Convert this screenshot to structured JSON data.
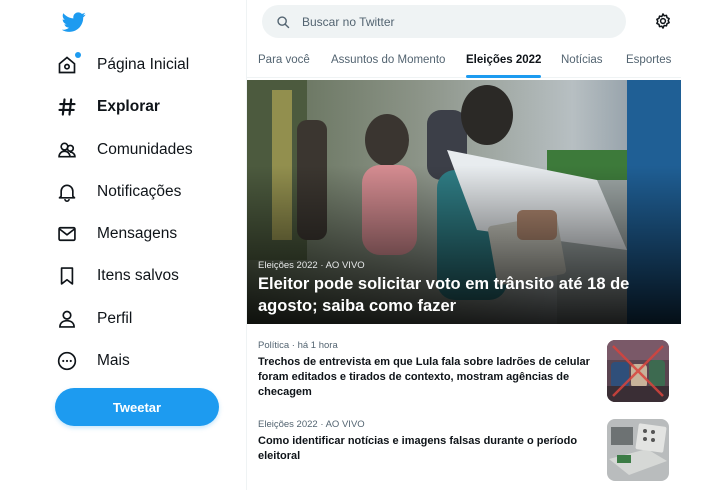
{
  "sidebar": {
    "items": [
      {
        "label": "Página Inicial",
        "icon": "home-icon"
      },
      {
        "label": "Explorar",
        "icon": "hashtag-icon"
      },
      {
        "label": "Comunidades",
        "icon": "communities-icon"
      },
      {
        "label": "Notificações",
        "icon": "bell-icon"
      },
      {
        "label": "Mensagens",
        "icon": "envelope-icon"
      },
      {
        "label": "Itens salvos",
        "icon": "bookmark-icon"
      },
      {
        "label": "Perfil",
        "icon": "person-icon"
      },
      {
        "label": "Mais",
        "icon": "more-circle-icon"
      }
    ],
    "active": "Explorar",
    "tweet_label": "Tweetar"
  },
  "search": {
    "placeholder": "Buscar no Twitter"
  },
  "tabs": [
    {
      "label": "Para você"
    },
    {
      "label": "Assuntos do Momento"
    },
    {
      "label": "Eleições 2022"
    },
    {
      "label": "Notícias"
    },
    {
      "label": "Esportes"
    }
  ],
  "active_tab": "Eleições 2022",
  "hero": {
    "meta": "Eleições 2022 · AO VIVO",
    "title": "Eleitor pode solicitar voto em trânsito até 18 de agosto; saiba como fazer"
  },
  "news": [
    {
      "meta": "Política · há 1 hora",
      "title": "Trechos de entrevista em que Lula fala sobre ladrões de celular foram editados e tirados de contexto, mostram agências de checagem"
    },
    {
      "meta": "Eleições 2022 · AO VIVO",
      "title": "Como identificar notícias e imagens falsas durante o período eleitoral"
    }
  ],
  "colors": {
    "accent": "#1d9bf0",
    "text": "#0f1419",
    "secondary": "#536471"
  }
}
